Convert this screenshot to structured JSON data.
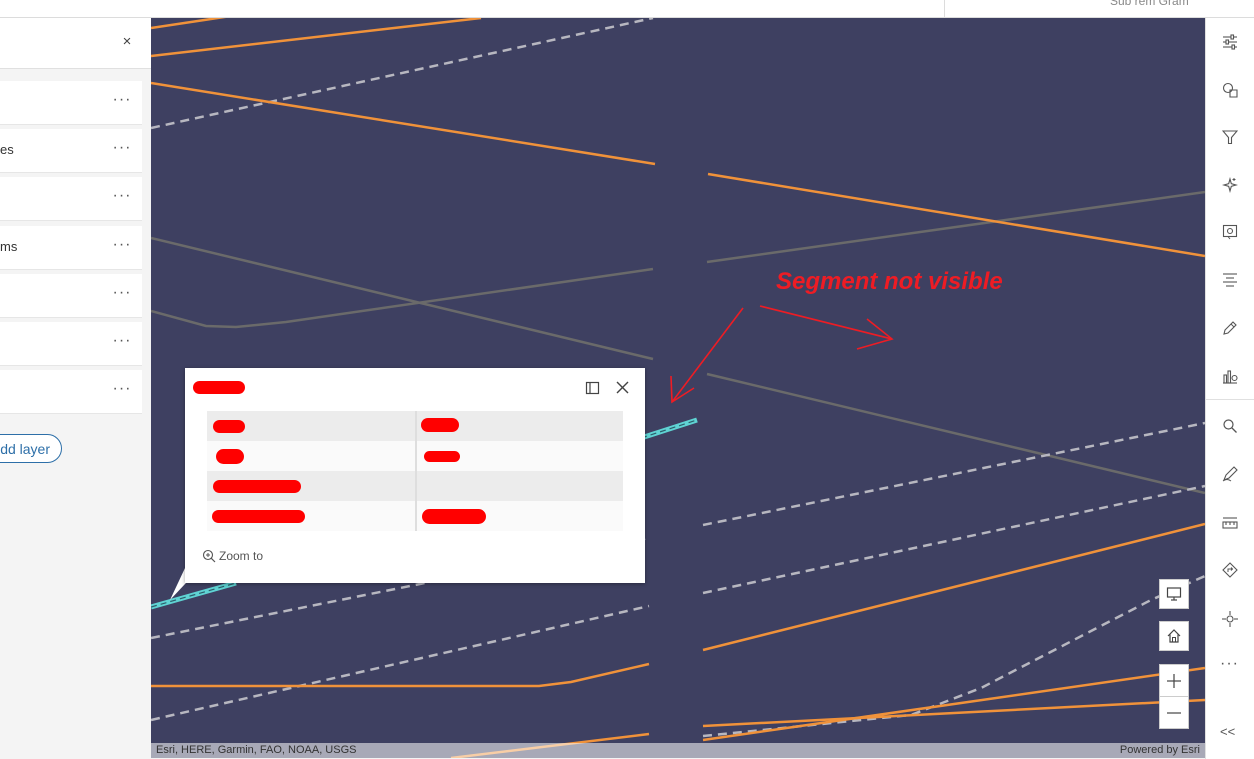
{
  "topbar": {
    "label": "Sub rem Gram"
  },
  "layer_panel": {
    "close_label": "×",
    "more_label": "···",
    "items": [
      {
        "label": ""
      },
      {
        "label": "es"
      },
      {
        "label": ""
      },
      {
        "label": "ms"
      },
      {
        "label": ""
      },
      {
        "label": ""
      },
      {
        "label": ""
      }
    ],
    "add_layer_label": "dd layer"
  },
  "map": {
    "annotation": "Segment not visible",
    "attribution_left": "Esri, HERE, Garmin, FAO, NOAA, USGS",
    "attribution_right": "Powered by Esri",
    "colors": {
      "background": "#3e4061",
      "orange": "#f0923a",
      "dashed": "#b7b7c0",
      "grey": "#6a6a6a",
      "highlight": "#5fd3d3",
      "annotation": "#ee1c24"
    }
  },
  "popup": {
    "zoom_to_label": "Zoom to",
    "rows": 4
  },
  "toolbar": {
    "tools": [
      "settings-sliders-icon",
      "shapes-icon",
      "filter-icon",
      "sparkle-icon",
      "gear-config-icon",
      "list-icon",
      "pen-icon",
      "chart-settings-icon",
      "search-icon",
      "sketch-icon",
      "measure-icon",
      "directions-icon",
      "locate-icon"
    ],
    "more_label": "···",
    "collapse_label": "<<"
  }
}
